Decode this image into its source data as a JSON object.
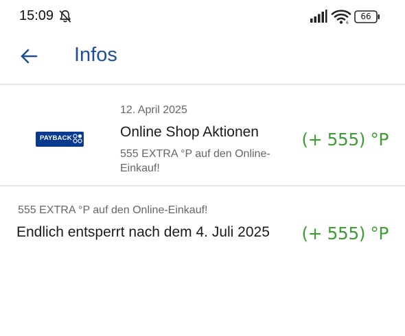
{
  "status_bar": {
    "time": "15:09",
    "battery": "66",
    "icons": [
      "bell-off-icon",
      "signal-icon",
      "wifi-icon",
      "battery-icon"
    ]
  },
  "app_bar": {
    "title": "Infos",
    "back_icon": "arrow-left-icon"
  },
  "entries": [
    {
      "logo_text": "PAYBACK",
      "date": "12. April 2025",
      "title": "Online Shop Aktionen",
      "description": "555 EXTRA °P auf den Online-Einkauf!",
      "points": "(+ 555) °P"
    },
    {
      "subtitle": "555 EXTRA °P auf den Online-Einkauf!",
      "title": "Endlich entsperrt nach dem 4. Juli 2025",
      "points": "(+ 555) °P"
    }
  ],
  "colors": {
    "title_blue": "#1d4f96",
    "points_green": "#3e9c35",
    "payback_blue": "#0a3a8e"
  }
}
